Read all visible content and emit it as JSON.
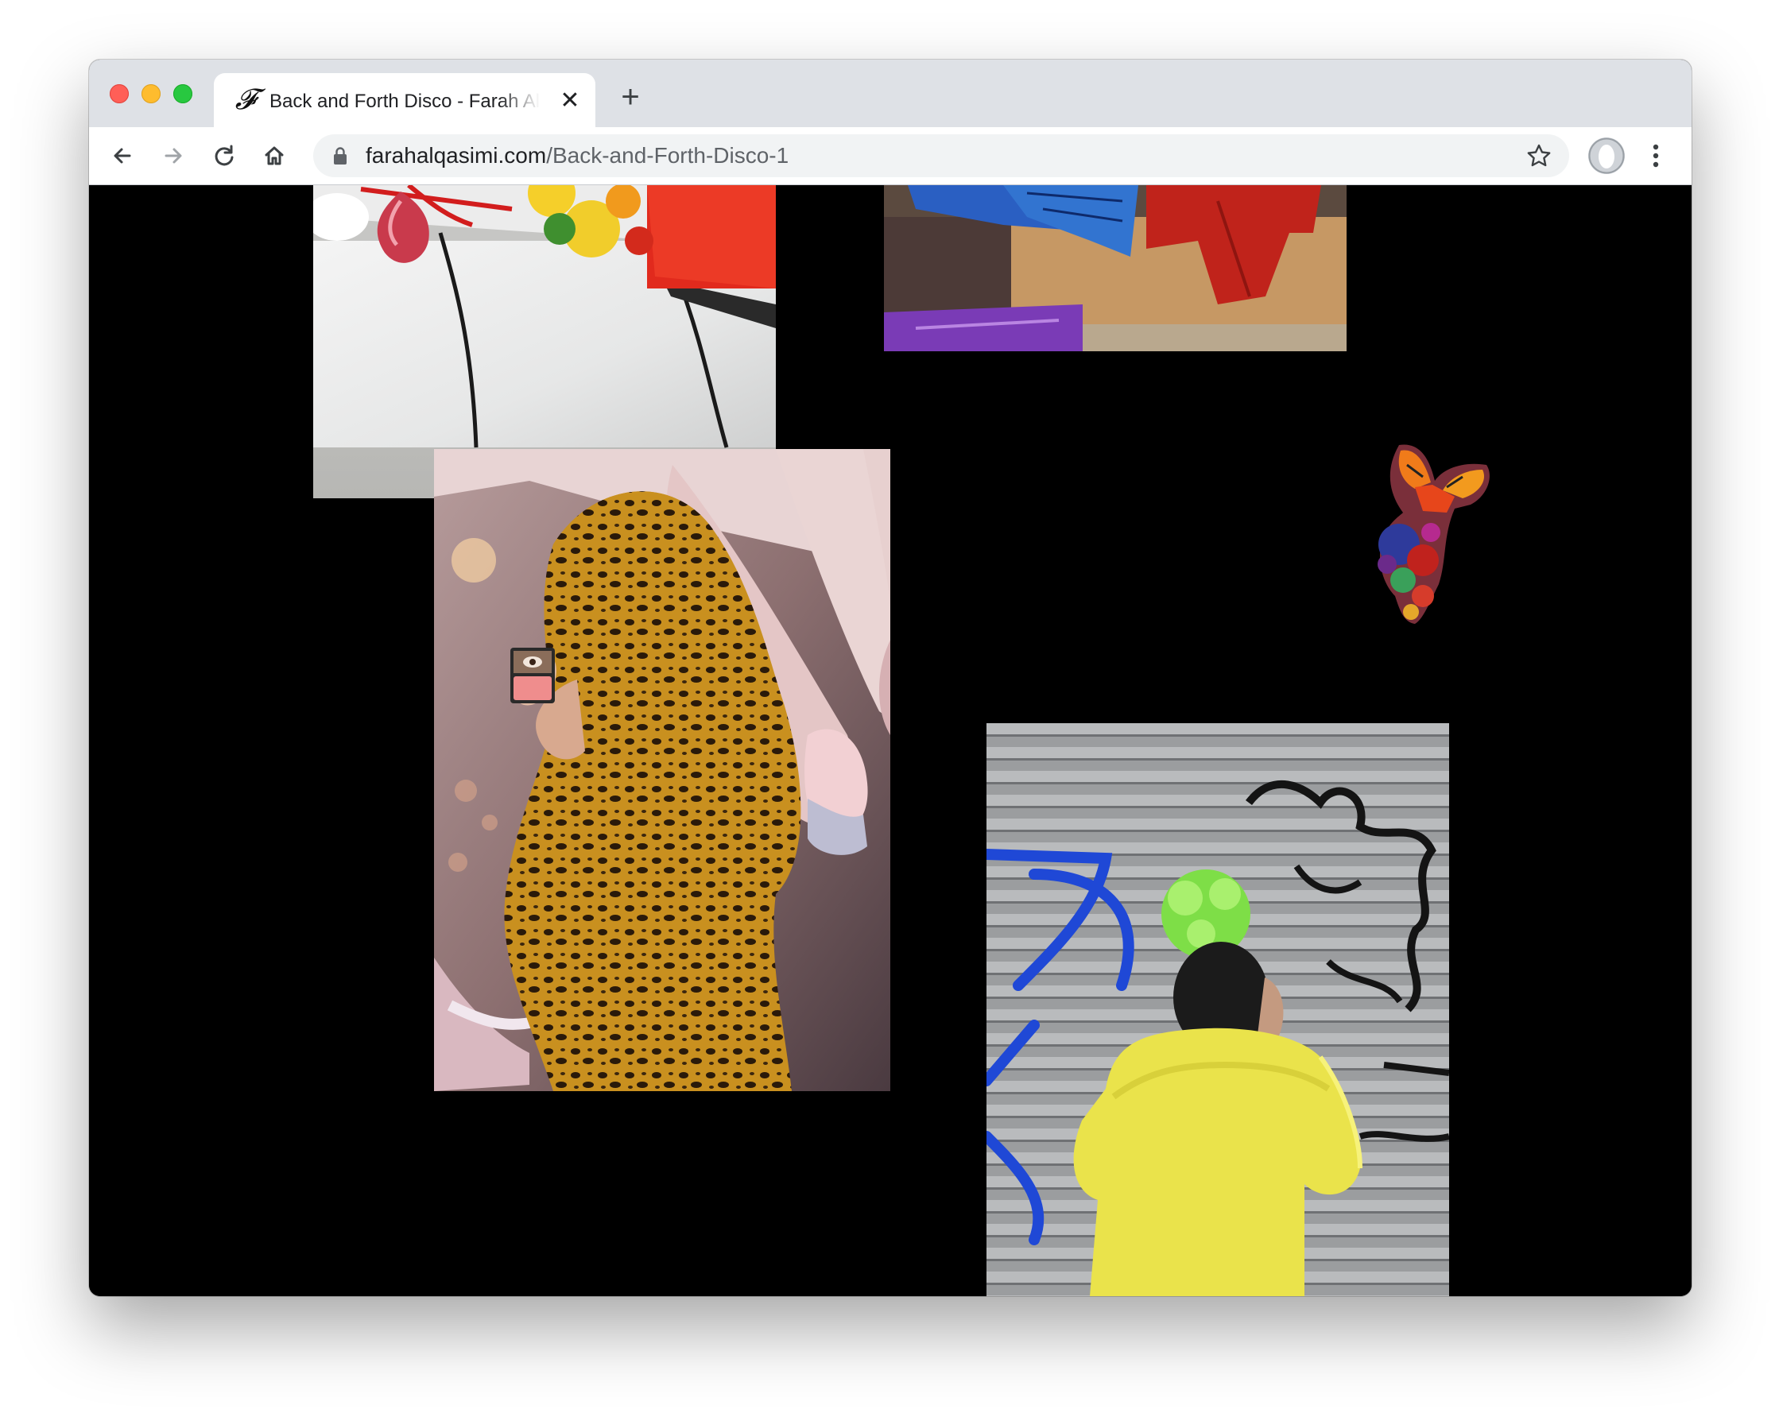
{
  "browser": {
    "tab": {
      "favicon": "𝓕",
      "title": "Back and Forth Disco - Farah Al Qasimi",
      "close_glyph": "✕"
    },
    "new_tab_glyph": "+",
    "address": {
      "domain": "farahalqasimi.com",
      "path": "/Back-and-Forth-Disco-1"
    },
    "icons": {
      "back": "back-arrow-icon",
      "forward": "forward-arrow-icon",
      "reload": "reload-icon",
      "home": "home-icon",
      "lock": "lock-icon",
      "bookmark": "star-icon",
      "profile": "profile-avatar-icon",
      "menu": "kebab-menu-icon"
    }
  },
  "page": {
    "background": "#000000",
    "images": [
      {
        "subject": "white car door with red flowers and pink gem"
      },
      {
        "subject": "colorful fabrics on wooden shelf"
      },
      {
        "subject": "woman in leopard print hijab holding compact mirror"
      },
      {
        "subject": "butterfly floral cutout"
      },
      {
        "subject": "woman in yellow fur coat with green hair scrunchie against graffiti shutter"
      }
    ]
  }
}
